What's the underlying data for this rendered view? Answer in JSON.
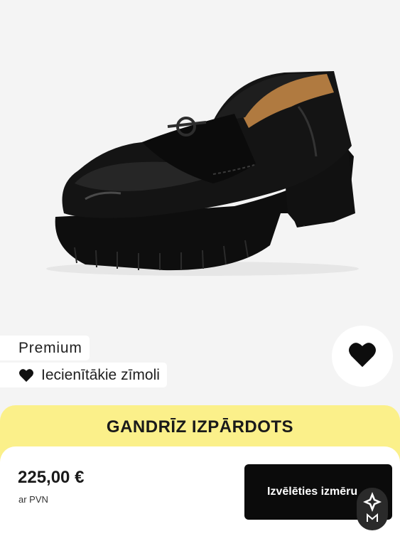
{
  "product": {
    "image_icon": "black-loafer-shoe"
  },
  "tags": {
    "premium": "Premium",
    "popular": "Iecienītākie zīmoli",
    "popular_icon": "heart-icon"
  },
  "wishlist": {
    "icon": "heart-icon"
  },
  "banner": {
    "text": "GANDRĪZ IZPĀRDOTS",
    "color": "#fbf08a"
  },
  "purchase": {
    "price": "225,00 €",
    "vat_note": "ar PVN",
    "button_label": "Izvēlēties izmēru"
  },
  "assistant": {
    "icon": "assistant-logo-icon"
  }
}
